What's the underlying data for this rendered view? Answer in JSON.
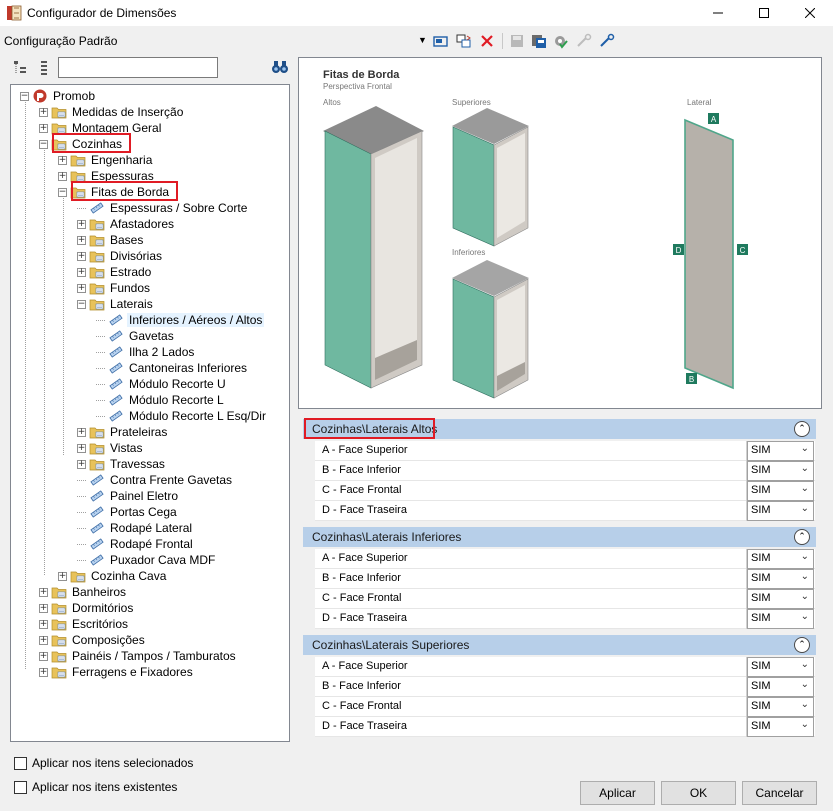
{
  "window": {
    "title": "Configurador de Dimensões",
    "minimize_icon": "minimize-icon",
    "maximize_icon": "maximize-icon",
    "close_icon": "close-icon"
  },
  "toolbar": {
    "config_title": "Configuração Padrão"
  },
  "tree": {
    "root": "Promob",
    "items": {
      "medidas": "Medidas de Inserção",
      "montagem": "Montagem Geral",
      "cozinhas": "Cozinhas",
      "engenharia": "Engenharia",
      "espessuras": "Espessuras",
      "fitas": "Fitas de Borda",
      "espessuras_sobre": "Espessuras / Sobre Corte",
      "afastadores": "Afastadores",
      "bases": "Bases",
      "divisorias": "Divisórias",
      "estrado": "Estrado",
      "fundos": "Fundos",
      "laterais": "Laterais",
      "inferiores_aereos": "Inferiores / Aéreos / Altos",
      "gavetas": "Gavetas",
      "ilha": "Ilha 2 Lados",
      "cantoneiras": "Cantoneiras Inferiores",
      "recorte_u": "Módulo Recorte U",
      "recorte_l": "Módulo Recorte L",
      "recorte_l_esq": "Módulo Recorte L Esq/Dir",
      "prateleiras": "Prateleiras",
      "vistas": "Vistas",
      "travessas": "Travessas",
      "contra_frente": "Contra Frente Gavetas",
      "painel_eletro": "Painel Eletro",
      "portas_cega": "Portas Cega",
      "rodape_lateral": "Rodapé Lateral",
      "rodape_frontal": "Rodapé Frontal",
      "puxador": "Puxador Cava MDF",
      "cozinha_cava": "Cozinha Cava",
      "banheiros": "Banheiros",
      "dormitorios": "Dormitórios",
      "escritorios": "Escritórios",
      "composicoes": "Composições",
      "paineis": "Painéis / Tampos / Tamburatos",
      "ferragens": "Ferragens e Fixadores"
    }
  },
  "preview": {
    "title": "Fitas de Borda",
    "subtitle": "Perspectiva Frontal",
    "label_altos": "Altos",
    "label_superiores": "Superiores",
    "label_inferiores": "Inferiores",
    "label_lateral": "Lateral",
    "edge_a": "A",
    "edge_b": "B",
    "edge_c": "C",
    "edge_d": "D",
    "edge_color": "#4fa68a"
  },
  "sections": [
    {
      "header": "Cozinhas\\Laterais Altos",
      "rows": [
        {
          "label": "A - Face Superior",
          "value": "SIM"
        },
        {
          "label": "B - Face Inferior",
          "value": "SIM"
        },
        {
          "label": "C - Face Frontal",
          "value": "SIM"
        },
        {
          "label": "D - Face Traseira",
          "value": "SIM"
        }
      ]
    },
    {
      "header": "Cozinhas\\Laterais Inferiores",
      "rows": [
        {
          "label": "A - Face Superior",
          "value": "SIM"
        },
        {
          "label": "B - Face Inferior",
          "value": "SIM"
        },
        {
          "label": "C - Face Frontal",
          "value": "SIM"
        },
        {
          "label": "D - Face Traseira",
          "value": "SIM"
        }
      ]
    },
    {
      "header": "Cozinhas\\Laterais Superiores",
      "rows": [
        {
          "label": "A - Face Superior",
          "value": "SIM"
        },
        {
          "label": "B - Face Inferior",
          "value": "SIM"
        },
        {
          "label": "C - Face Frontal",
          "value": "SIM"
        },
        {
          "label": "D - Face Traseira",
          "value": "SIM"
        }
      ]
    }
  ],
  "options": {
    "apply_selected": "Aplicar nos itens selecionados",
    "apply_existing": "Aplicar nos itens existentes"
  },
  "buttons": {
    "apply": "Aplicar",
    "ok": "OK",
    "cancel": "Cancelar"
  },
  "colors": {
    "selection_red": "#e01b24",
    "section_header_bg": "#b7cfe9",
    "folder_yellow": "#e8c25a"
  }
}
